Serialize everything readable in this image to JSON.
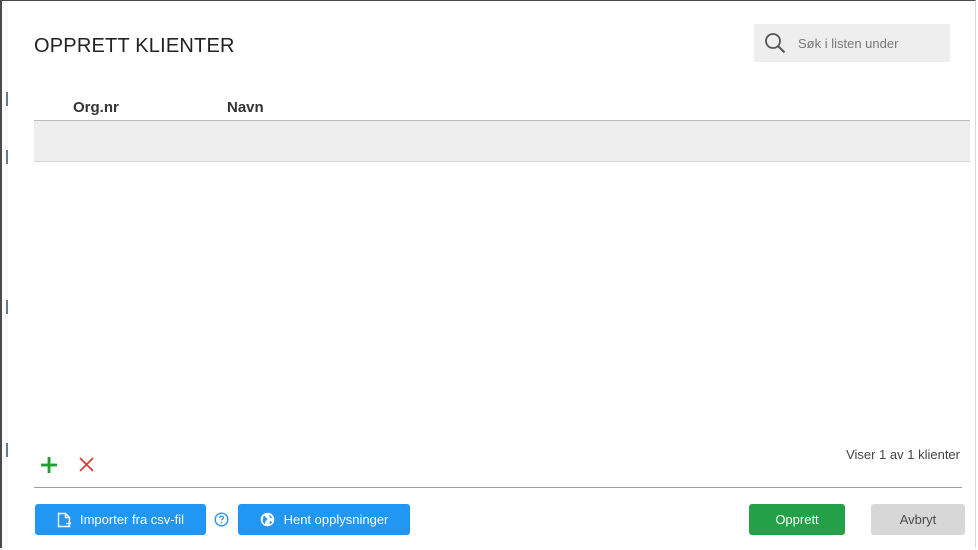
{
  "dialog": {
    "title": "OPPRETT KLIENTER"
  },
  "search": {
    "placeholder": "Søk i listen under",
    "icon": "search-icon"
  },
  "table": {
    "columns": [
      "Org.nr",
      "Navn"
    ],
    "rows": [
      {
        "org_nr": "",
        "navn": ""
      }
    ]
  },
  "row_actions": {
    "add_icon": "plus-icon",
    "remove_icon": "close-icon"
  },
  "status": {
    "count_text": "Viser 1 av 1 klienter"
  },
  "footer": {
    "import_label": "Importer fra csv-fil",
    "fetch_label": "Hent opplysninger",
    "create_label": "Opprett",
    "cancel_label": "Avbryt"
  },
  "colors": {
    "primary_blue": "#2196f3",
    "create_green": "#24a148",
    "add_green": "#1e9e2f",
    "remove_red": "#e53935",
    "cancel_gray": "#d7d7d7"
  }
}
